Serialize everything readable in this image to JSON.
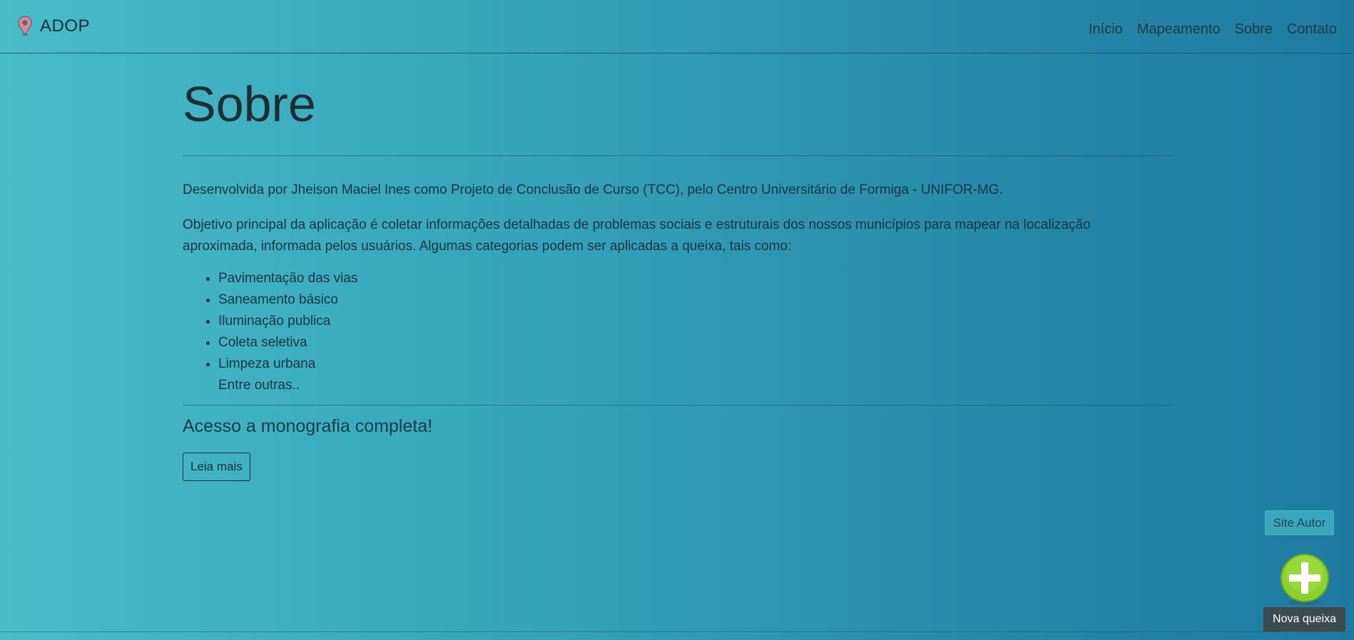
{
  "navbar": {
    "brand": "ADOP",
    "brand_icon": "map-pin-icon",
    "links": [
      "Início",
      "Mapeamento",
      "Sobre",
      "Contato"
    ]
  },
  "main": {
    "title": "Sobre",
    "paragraph1": "Desenvolvida por Jheison Maciel Ines como Projeto de Conclusão de Curso (TCC), pelo Centro Universitário de Formiga - UNIFOR-MG.",
    "paragraph2_line1": "Objetivo principal da aplicação é coletar informações detalhadas de problemas sociais e estruturais dos nossos municípios para mapear na localização",
    "paragraph2_line2": "aproximada, informada pelos usuários. Algumas categorias podem ser aplicadas a queixa, tais como:",
    "categories": [
      "Pavimentação das vias",
      "Saneamento básico",
      "Iluminação publica",
      "Coleta seletiva",
      "Limpeza urbana"
    ],
    "others": "Entre outras..",
    "monograph_heading": "Acesso a monografia completa!",
    "read_more_label": "Leia mais"
  },
  "floating": {
    "author_site_label": "Site Autor",
    "new_complaint_icon": "plus-circle-icon",
    "new_complaint_label": "Nova queixa"
  },
  "colors": {
    "gradient_start": "#48bcc7",
    "gradient_end": "#1f7aa1",
    "fab_green": "#8bd12c",
    "pin_color": "#d9899a"
  }
}
